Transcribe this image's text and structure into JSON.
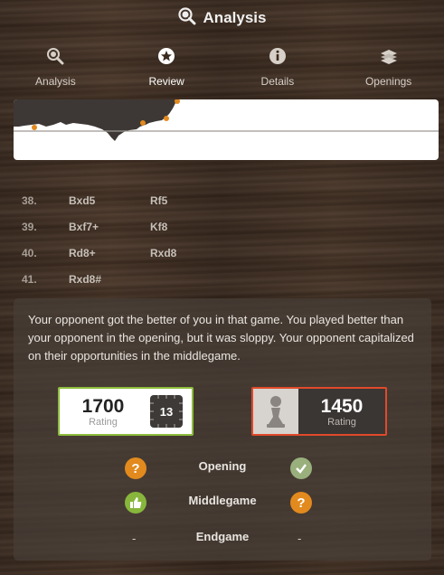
{
  "header": {
    "title": "Analysis",
    "icon": "magnifier-chart-icon"
  },
  "tabs": [
    {
      "label": "Analysis",
      "icon": "magnifier-icon",
      "active": false
    },
    {
      "label": "Review",
      "icon": "star-circle-icon",
      "active": true
    },
    {
      "label": "Details",
      "icon": "info-icon",
      "active": false
    },
    {
      "label": "Openings",
      "icon": "book-stack-icon",
      "active": false
    }
  ],
  "colors": {
    "accent_orange": "#e28a1e",
    "win_green": "#8dbd3d",
    "loss_red": "#e04a2a"
  },
  "moves": [
    {
      "num": "38.",
      "white": "Bxd5",
      "black": "Rf5"
    },
    {
      "num": "39.",
      "white": "Bxf7+",
      "black": "Kf8"
    },
    {
      "num": "40.",
      "white": "Rd8+",
      "black": "Rxd8"
    },
    {
      "num": "41.",
      "white": "Rxd8#",
      "black": ""
    }
  ],
  "summary": {
    "text": "Your opponent got the better of you in that game. You played better than your opponent in the opening, but it was sloppy. Your opponent capitalized on their opportunities in the middlegame."
  },
  "player": {
    "rating": "1700",
    "rating_label": "Rating",
    "engine_level": "13"
  },
  "opponent": {
    "rating": "1450",
    "rating_label": "Rating"
  },
  "phases": [
    {
      "name": "Opening",
      "left": "question",
      "right": "check"
    },
    {
      "name": "Middlegame",
      "left": "thumbs-up",
      "right": "question"
    },
    {
      "name": "Endgame",
      "left": "-",
      "right": "-"
    }
  ]
}
